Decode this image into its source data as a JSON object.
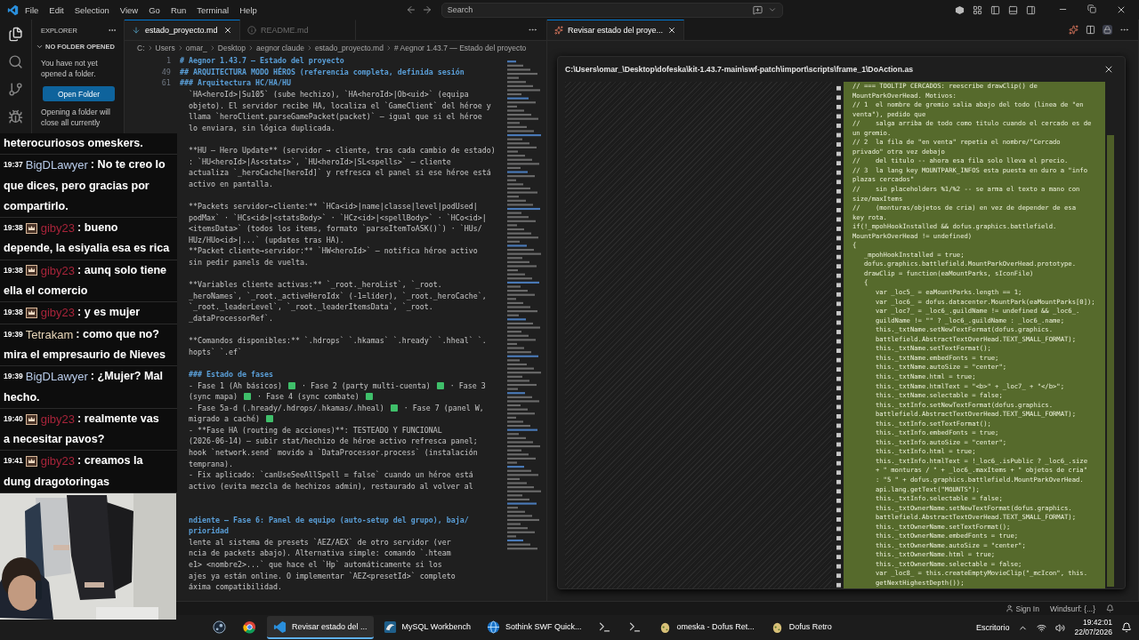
{
  "menu": [
    "File",
    "Edit",
    "Selection",
    "View",
    "Go",
    "Run",
    "Terminal",
    "Help"
  ],
  "search": {
    "placeholder": "Search"
  },
  "explorer": {
    "title": "EXPLORER",
    "section": "NO FOLDER OPENED",
    "message": "You have not yet opened a folder.",
    "button": "Open Folder",
    "note": "Opening a folder will close all currently"
  },
  "left_editor": {
    "tabs": [
      {
        "label": "estado_proyecto.md",
        "selected": true
      },
      {
        "label": "README.md",
        "selected": false
      }
    ],
    "breadcrumb": [
      "C:",
      "Users",
      "omar_",
      "Desktop",
      "aegnor claude",
      "estado_proyecto.md",
      "# Aegnor 1.43.7 — Estado del proyecto"
    ],
    "lines": [
      {
        "n": "1",
        "kind": "heading",
        "text": "# Aegnor 1.43.7 — Estado del proyecto"
      },
      {
        "n": "49",
        "kind": "heading",
        "text": "## ARQUITECTURA MODO HÉROS (referencia completa, definida sesión"
      },
      {
        "n": "61",
        "kind": "heading",
        "text": "### Arquitectura HC/HA/HU"
      },
      {
        "kind": "text",
        "text": "`HA<heroId>|Su105` (sube hechizo), `HA<heroId>|Ob<uid>` (equipa"
      },
      {
        "kind": "text",
        "text": "objeto). El servidor recibe HA, localiza el `GameClient` del héroe y"
      },
      {
        "kind": "text",
        "text": "llama `heroClient.parseGamePacket(packet)` — igual que si el héroe"
      },
      {
        "kind": "text",
        "text": "lo enviara, sin lógica duplicada."
      },
      {
        "kind": "blank"
      },
      {
        "kind": "text",
        "text": "**HU — Hero Update** (servidor → cliente, tras cada cambio de estado)"
      },
      {
        "kind": "text",
        "text": ": `HU<heroId>|As<stats>`, `HU<heroId>|SL<spells>` — cliente"
      },
      {
        "kind": "text",
        "text": "actualiza `_heroCache[heroId]` y refresca el panel si ese héroe está"
      },
      {
        "kind": "text",
        "text": "activo en pantalla."
      },
      {
        "kind": "blank"
      },
      {
        "kind": "text",
        "text": "**Packets servidor→cliente:** `HCa<id>|name|classe|level|podUsed|"
      },
      {
        "kind": "text",
        "text": "podMax` · `HCs<id>|<statsBody>` · `HCz<id>|<spellBody>` · `HCo<id>|"
      },
      {
        "kind": "text",
        "text": "<itemsData>` (todos los items, formato `parseItemToASK()`) · `HUs/"
      },
      {
        "kind": "text",
        "text": "HUz/HUo<id>|...` (updates tras HA)."
      },
      {
        "kind": "text",
        "text": "**Packet cliente→servidor:** `HW<heroId>` — notifica héroe activo"
      },
      {
        "kind": "text",
        "text": "sin pedir panels de vuelta."
      },
      {
        "kind": "blank"
      },
      {
        "kind": "text",
        "text": "**Variables cliente activas:** `_root._heroList`, `_root."
      },
      {
        "kind": "text",
        "text": "_heroNames`, `_root._activeHeroIdx` (-1=líder), `_root._heroCache`,"
      },
      {
        "kind": "text",
        "text": "`_root._leaderLevel`, `_root._leaderItemsData`, `_root."
      },
      {
        "kind": "text",
        "text": "_dataProcessorRef`."
      },
      {
        "kind": "blank"
      },
      {
        "kind": "text",
        "text": "**Comandos disponibles:** `.hdrops` `.hkamas` `.hready` `.hheal` `."
      },
      {
        "kind": "text",
        "text": "hopts` `.ef`"
      },
      {
        "kind": "blank"
      },
      {
        "kind": "heading",
        "text": "### Estado de fases"
      },
      {
        "kind": "text",
        "parts": [
          {
            "kind": "text",
            "text": "- Fase 1 (Ah básicos) "
          },
          {
            "kind": "check"
          },
          {
            "kind": "text",
            "text": " · Fase 2 (party multi-cuenta) "
          },
          {
            "kind": "check"
          },
          {
            "kind": "text",
            "text": " · Fase 3"
          }
        ]
      },
      {
        "kind": "text",
        "parts": [
          {
            "kind": "text",
            "text": "(sync mapa) "
          },
          {
            "kind": "check"
          },
          {
            "kind": "text",
            "text": " · Fase 4 (sync combate) "
          },
          {
            "kind": "check"
          }
        ]
      },
      {
        "kind": "text",
        "parts": [
          {
            "kind": "text",
            "text": "- Fase 5a-d (.hready/.hdrops/.hkamas/.hheal) "
          },
          {
            "kind": "check"
          },
          {
            "kind": "text",
            "text": " · Fase 7 (panel W,"
          }
        ]
      },
      {
        "kind": "text",
        "parts": [
          {
            "kind": "text",
            "text": "migrado a caché) "
          },
          {
            "kind": "check"
          }
        ]
      },
      {
        "kind": "text",
        "text": "- **Fase HA (routing de acciones)**: TESTEADO Y FUNCIONAL"
      },
      {
        "kind": "text",
        "text": "(2026-06-14) — subir stat/hechizo de héroe activo refresca panel;"
      },
      {
        "kind": "text",
        "text": "hook `network.send` movido a `DataProcessor.process` (instalación"
      },
      {
        "kind": "text",
        "text": "temprana)."
      },
      {
        "kind": "text",
        "text": "- Fix aplicado: `canUseSeeAllSpell = false` cuando un héroe está"
      },
      {
        "kind": "text",
        "text": "activo (evita mezcla de hechizos admin), restaurado al volver al"
      },
      {
        "kind": "blank"
      },
      {
        "kind": "blank"
      },
      {
        "kind": "heading",
        "text": "ndiente — Fase 6: Panel de equipo (auto-setup del grupo), baja/"
      },
      {
        "kind": "heading",
        "text": "prioridad"
      },
      {
        "kind": "text",
        "text": "lente al sistema de presets `AEZ/AEX` de otro servidor (ver"
      },
      {
        "kind": "text",
        "text": "ncia de packets abajo). Alternativa simple: comando `.hteam"
      },
      {
        "kind": "text",
        "text": "e1> <nombre2>...` que hace el `Hp` automáticamente si los"
      },
      {
        "kind": "text",
        "text": "ajes ya están online. O implementar `AEZ<presetId>` completo"
      },
      {
        "kind": "text",
        "text": "áxima compatibilidad."
      }
    ]
  },
  "right_editor": {
    "tabs": [
      {
        "label": "Revisar estado del proye...",
        "selected": true
      }
    ],
    "dialog": {
      "title": "C:\\Users\\omar_\\Desktop\\dofeska\\kit-1.43.7-main\\swf-patch\\import\\scripts\\frame_1\\DoAction.as",
      "lines": [
        "// === TOOLTIP CERCADOS: reescribe drawClip() de",
        "MountParkOverHead. Motivos:",
        "// 1  el nombre de gremio salia abajo del todo (linea de \"en",
        "venta\"), pedido que",
        "//    salga arriba de todo como titulo cuando el cercado es de",
        "un gremio.",
        "// 2  la fila de \"en venta\" repetia el nombre/\"Cercado",
        "privado\" otra vez debajo",
        "//    del titulo -- ahora esa fila solo lleva el precio.",
        "// 3  la lang key MOUNTPARK_INFOS esta puesta en duro a \"info",
        "plazas cercados\"",
        "//    sin placeholders %1/%2 -- se arma el texto a mano con",
        "size/maxItems",
        "//    (monturas/objetos de cria) en vez de depender de esa",
        "key rota.",
        "if(!_mpohHookInstalled && dofus.graphics.battlefield.",
        "MountParkOverHead != undefined)",
        "{",
        "   _mpohHookInstalled = true;",
        "   dofus.graphics.battlefield.MountParkOverHead.prototype.",
        "   drawClip = function(eaMountParks, sIconFile)",
        "   {",
        "      var _loc5_ = eaMountParks.length == 1;",
        "      var _loc6_ = dofus.datacenter.MountPark(eaMountParks[0]);",
        "      var _loc7_ = _loc6_.guildName != undefined && _loc6_.",
        "      guildName != \"\" ? _loc6_.guildName : _loc6_.name;",
        "      this._txtName.setNewTextFormat(dofus.graphics.",
        "      battlefield.AbstractTextOverHead.TEXT_SMALL_FORMAT);",
        "      this._txtName.setTextFormat();",
        "      this._txtName.embedFonts = true;",
        "      this._txtName.autoSize = \"center\";",
        "      this._txtName.html = true;",
        "      this._txtName.htmlText = \"<b>\" + _loc7_ + \"</b>\";",
        "      this._txtName.selectable = false;",
        "      this._txtInfo.setNewTextFormat(dofus.graphics.",
        "      battlefield.AbstractTextOverHead.TEXT_SMALL_FORMAT);",
        "      this._txtInfo.setTextFormat();",
        "      this._txtInfo.embedFonts = true;",
        "      this._txtInfo.autoSize = \"center\";",
        "      this._txtInfo.html = true;",
        "      this._txtInfo.htmlText = !_loc6_.isPublic ? _loc6_.size",
        "      + \" monturas / \" + _loc6_.maxItems + \" objetos de cria\"",
        "      : \"5 \" + dofus.graphics.battlefield.MountParkOverHead.",
        "      api.lang.getText(\"MOUNTS\");",
        "      this._txtInfo.selectable = false;",
        "      this._txtOwnerName.setNewTextFormat(dofus.graphics.",
        "      battlefield.AbstractTextOverHead.TEXT_SMALL_FORMAT);",
        "      this._txtOwnerName.setTextFormat();",
        "      this._txtOwnerName.embedFonts = true;",
        "      this._txtOwnerName.autoSize = \"center\";",
        "      this._txtOwnerName.html = true;",
        "      this._txtOwnerName.selectable = false;",
        "      var _loc8_ = this.createEmptyMovieClip(\"_mcIcon\", this.",
        "      getNextHighestDepth());"
      ]
    }
  },
  "chat": [
    {
      "lines": [
        "heterocuriosos omeskers."
      ]
    },
    {
      "time": "19:37",
      "user": "BigDLawyer",
      "color": "#b8cbe9",
      "badge": false,
      "lines": [
        ": No te creo lo",
        "que dices, pero gracias por",
        "compartirlo."
      ]
    },
    {
      "time": "19:38",
      "user": "giby23",
      "color": "#a8243a",
      "badge": true,
      "lines": [
        ": bueno",
        "depende, la esiyalia esa es rica"
      ]
    },
    {
      "time": "19:38",
      "user": "giby23",
      "color": "#a8243a",
      "badge": true,
      "lines": [
        ": aunq solo tiene",
        "ella el comercio"
      ]
    },
    {
      "time": "19:38",
      "user": "giby23",
      "color": "#a8243a",
      "badge": true,
      "lines": [
        ": y es mujer"
      ]
    },
    {
      "time": "19:39",
      "user": "Tetrakam",
      "color": "#e8d6b8",
      "badge": false,
      "lines": [
        ": como que no?",
        "mira el empresaurio de Nieves"
      ]
    },
    {
      "time": "19:39",
      "user": "BigDLawyer",
      "color": "#b8cbe9",
      "badge": false,
      "lines": [
        ": ¿Mujer? Mal",
        "hecho."
      ]
    },
    {
      "time": "19:40",
      "user": "giby23",
      "color": "#a8243a",
      "badge": true,
      "lines": [
        ": realmente vas",
        "a necesitar pavos?"
      ]
    },
    {
      "time": "19:41",
      "user": "giby23",
      "color": "#a8243a",
      "badge": true,
      "lines": [
        ": creamos la",
        "dung dragotoringas"
      ]
    }
  ],
  "status_bar": {
    "sign_in": "Sign In",
    "extension": "Windsurf: {...}"
  },
  "taskbar": {
    "apps": [
      {
        "kind": "steam",
        "selected": false
      },
      {
        "kind": "chrome",
        "selected": false
      },
      {
        "kind": "vscode",
        "label": "Revisar estado del ...",
        "selected": true
      },
      {
        "kind": "mysql",
        "label": "MySQL Workbench",
        "selected": false
      },
      {
        "kind": "sothink",
        "label": "Sothink SWF Quick...",
        "selected": false
      },
      {
        "kind": "terminal",
        "selected": false
      },
      {
        "kind": "terminal",
        "selected": false
      },
      {
        "kind": "dofus",
        "label": "omeska - Dofus Ret...",
        "selected": false
      },
      {
        "kind": "dofus",
        "label": "Dofus Retro",
        "selected": false
      }
    ],
    "desktop": "Escritorio",
    "time": "19:42:01",
    "date": "22/07/2026"
  }
}
